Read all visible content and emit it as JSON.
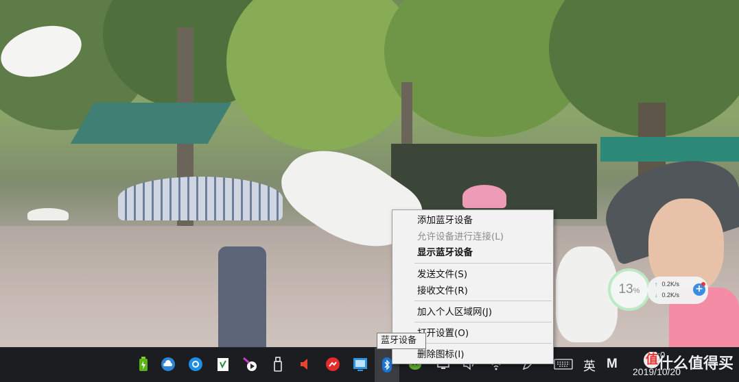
{
  "context_menu": {
    "items": [
      {
        "label": "添加蓝牙设备",
        "enabled": true,
        "bold": false
      },
      {
        "label": "允许设备进行连接(L)",
        "enabled": false,
        "bold": false
      },
      {
        "label": "显示蓝牙设备",
        "enabled": true,
        "bold": true
      },
      {
        "label": "发送文件(S)",
        "enabled": true,
        "bold": false
      },
      {
        "label": "接收文件(R)",
        "enabled": true,
        "bold": false
      },
      {
        "label": "加入个人区域网(J)",
        "enabled": true,
        "bold": false
      },
      {
        "label": "打开设置(O)",
        "enabled": true,
        "bold": false
      },
      {
        "label": "删除图标(I)",
        "enabled": true,
        "bold": false
      }
    ]
  },
  "tooltip": {
    "text": "蓝牙设备"
  },
  "net_widget": {
    "cpu_percent": "13",
    "cpu_unit": "%",
    "upload_speed": "0.2K/s",
    "download_speed": "0.2K/s",
    "boost_symbol": "+"
  },
  "taskbar": {
    "tray_icons": [
      {
        "name": "battery-icon"
      },
      {
        "name": "cloud-icon"
      },
      {
        "name": "browser-icon"
      },
      {
        "name": "clipboard-icon"
      },
      {
        "name": "media-player-icon"
      },
      {
        "name": "usb-drive-icon"
      },
      {
        "name": "speaker-red-icon"
      },
      {
        "name": "app-red-icon"
      },
      {
        "name": "screen-share-icon"
      },
      {
        "name": "bluetooth-icon"
      },
      {
        "name": "wechat-icon"
      },
      {
        "name": "display-icon"
      },
      {
        "name": "volume-icon"
      },
      {
        "name": "wifi-icon"
      },
      {
        "name": "pen-icon"
      },
      {
        "name": "keyboard-icon"
      }
    ],
    "ime_label": "英",
    "ime_mode_label": "M",
    "clock_time": "22:0",
    "clock_date": "2019/10/20"
  },
  "watermark": {
    "logo_char": "值",
    "text": "什么值得买"
  },
  "colors": {
    "menu_bg": "#f2f2f2",
    "taskbar_bg": "#1b1d20",
    "disabled_text": "#8c8c8c",
    "accent_blue": "#3c8de0"
  }
}
